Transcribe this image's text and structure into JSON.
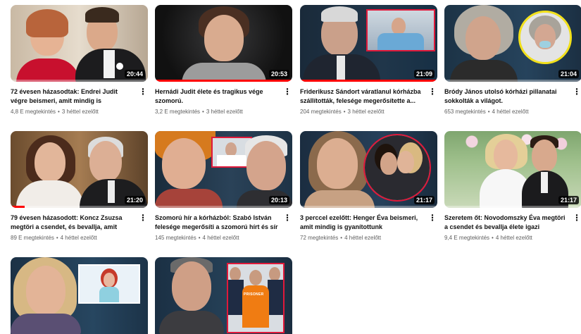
{
  "videos": [
    {
      "title": "72 évesen házasodtak: Endrei Judit végre beismeri, amit mindig is gyanítottunk",
      "views": "4,8 E megtekintés",
      "age": "3 héttel ezelőtt",
      "duration": "20:44",
      "progress": 0.0
    },
    {
      "title": "Hernádi Judit élete és tragikus vége szomorú.",
      "views": "3,2 E megtekintés",
      "age": "3 héttel ezelőtt",
      "duration": "20:53",
      "progress": 1.0
    },
    {
      "title": "Friderikusz Sándort váratlanul kórházba szállították, felesége megerősítette a...",
      "views": "204 megtekintés",
      "age": "3 héttel ezelőtt",
      "duration": "21:09",
      "progress": 1.0
    },
    {
      "title": "Bródy János utolsó kórházi pillanatai sokkolták a világot.",
      "views": "653 megtekintés",
      "age": "4 héttel ezelőtt",
      "duration": "21:04",
      "progress": 0.0
    },
    {
      "title": "79 évesen házasodott: Koncz Zsuzsa megtöri a csendet, és bevallja, amit mindig ...",
      "views": "89 E megtekintés",
      "age": "4 héttel ezelőtt",
      "duration": "21:20",
      "progress": 0.1
    },
    {
      "title": "Szomorú hír a kórházból: Szabó István felesége megerősíti a szomorú hírt és sír",
      "views": "145 megtekintés",
      "age": "4 héttel ezelőtt",
      "duration": "20:13",
      "progress": 0.0
    },
    {
      "title": "3 perccel ezelőtt: Henger Éva beismeri, amit mindig is gyanítottunk",
      "views": "72 megtekintés",
      "age": "4 héttel ezelőtt",
      "duration": "21:17",
      "progress": 0.0
    },
    {
      "title": "Szeretem őt: Novodomszky Éva megtöri a csendet és bevallja élete igazi szerelmét",
      "views": "9,4 E megtekintés",
      "age": "4 héttel ezelőtt",
      "duration": "21:17",
      "progress": 0.0
    },
    {
      "title": "",
      "views": "",
      "age": "",
      "duration": "",
      "progress": 0.0
    },
    {
      "title": "",
      "views": "",
      "age": "",
      "duration": "",
      "progress": 0.0,
      "prison_label": "PRISONER"
    }
  ],
  "separator": "•",
  "more_icon": "more-vertical-icon",
  "colors": {
    "progress": "#ff0000",
    "inset_border": "#e0193a",
    "inset_border_yellow": "#f3e11b",
    "title_text": "#0f0f0f",
    "meta_text": "#606060"
  }
}
